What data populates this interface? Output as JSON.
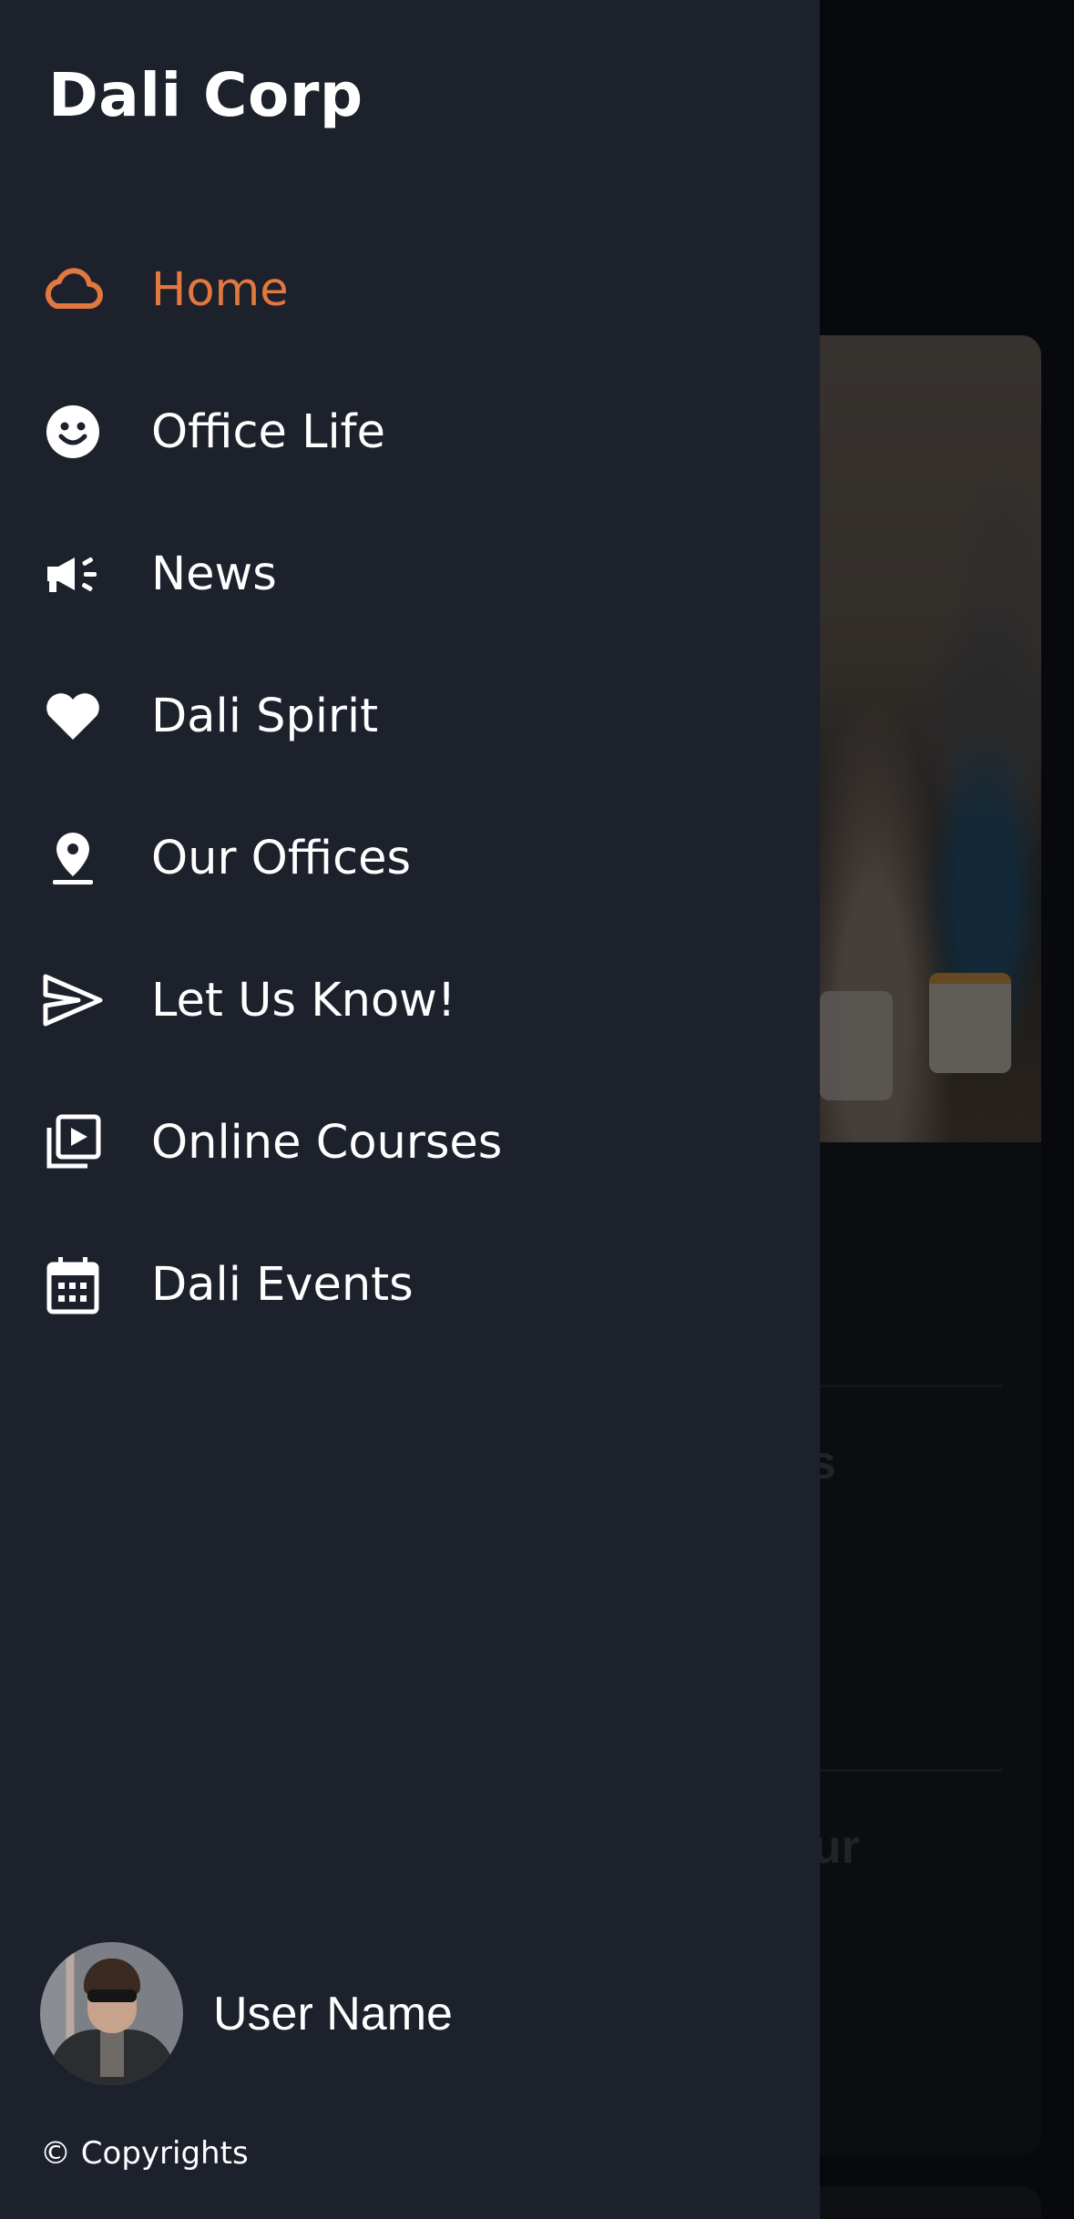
{
  "drawer": {
    "brand": "Dali Corp",
    "menu": [
      {
        "label": "Home",
        "icon": "cloud-icon",
        "active": true
      },
      {
        "label": "Office Life",
        "icon": "smile-icon"
      },
      {
        "label": "News",
        "icon": "megaphone-icon"
      },
      {
        "label": "Dali Spirit",
        "icon": "heart-icon"
      },
      {
        "label": "Our Offices",
        "icon": "map-pin-icon"
      },
      {
        "label": "Let Us Know!",
        "icon": "send-icon"
      },
      {
        "label": "Online Courses",
        "icon": "video-library-icon"
      },
      {
        "label": "Dali Events",
        "icon": "calendar-icon"
      }
    ],
    "user": {
      "name": "User Name"
    },
    "copyright": "© Copyrights"
  },
  "background": {
    "text_1": "es",
    "text_2": "our"
  },
  "colors": {
    "accent": "#e2773f",
    "drawer_bg": "#1c212c",
    "text": "#ffffff"
  }
}
